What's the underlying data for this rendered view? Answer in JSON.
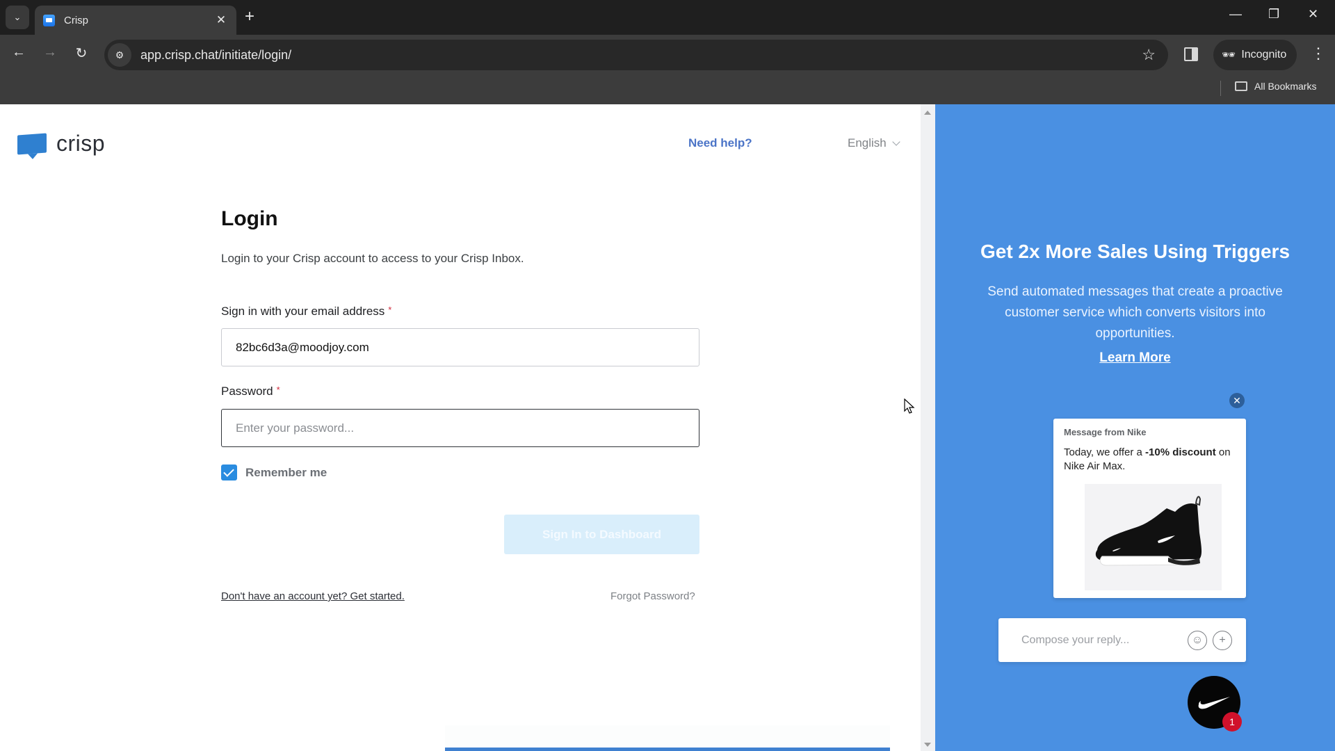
{
  "browser": {
    "tab": {
      "title": "Crisp",
      "close": "✕"
    },
    "new_tab": "+",
    "window_controls": {
      "minimize": "—",
      "restore": "❐",
      "close": "✕"
    },
    "url": "app.crisp.chat/initiate/login/",
    "incognito_label": "Incognito",
    "bookmarks_label": "All Bookmarks"
  },
  "header": {
    "logo_text": "crisp",
    "need_help": "Need help?",
    "language": "English"
  },
  "login": {
    "title": "Login",
    "subtitle": "Login to your Crisp account to access to your Crisp Inbox.",
    "email_label": "Sign in with your email address",
    "email_value": "82bc6d3a@moodjoy.com",
    "password_label": "Password",
    "password_placeholder": "Enter your password...",
    "required_mark": "*",
    "remember_label": "Remember me",
    "remember_checked": true,
    "signin_button": "Sign In to Dashboard",
    "get_started": "Don't have an account yet? Get started.",
    "forgot": "Forgot Password?"
  },
  "promo": {
    "title": "Get 2x More Sales Using Triggers",
    "body": "Send automated messages that create a proactive customer service which converts visitors into opportunities.",
    "learn_more": "Learn More",
    "widget": {
      "from": "Message from Nike",
      "text_before": "Today, we offer a ",
      "text_bold": "-10% discount",
      "text_after": " on Nike Air Max.",
      "compose_placeholder": "Compose your reply...",
      "badge_count": "1"
    }
  },
  "colors": {
    "accent_blue": "#4a90e2",
    "link_blue": "#4b74c7",
    "badge_red": "#d0112b"
  }
}
